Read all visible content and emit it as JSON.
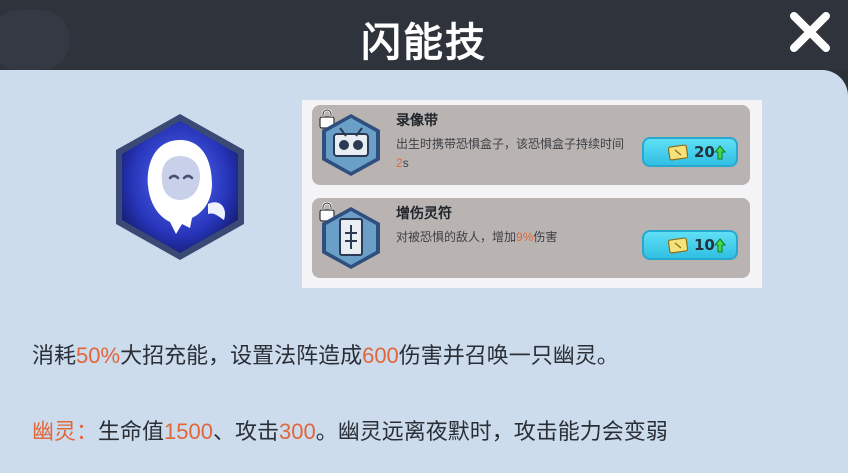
{
  "header": {
    "title": "闪能技"
  },
  "skill": {
    "icon": "hooded-ghost-icon"
  },
  "upgrades": [
    {
      "name": "录像带",
      "icon": "videotape-icon",
      "desc_pre": "出生时携带恐惧盒子，该恐惧盒子持续时间",
      "desc_value": "2",
      "desc_post": "s",
      "cost": "20",
      "locked": true
    },
    {
      "name": "增伤灵符",
      "icon": "talisman-icon",
      "desc_pre": "对被恐惧的敌人，增加",
      "desc_value": "9%",
      "desc_post": "伤害",
      "cost": "10",
      "locked": true
    }
  ],
  "description": {
    "line1": {
      "p1": "消耗",
      "v1": "50%",
      "p2": "大招充能，设置法阵造成",
      "v2": "600",
      "p3": "伤害并召唤一只幽灵。"
    },
    "line2": {
      "label": "幽灵：",
      "p1": "生命值",
      "v1": "1500",
      "p2": "、攻击",
      "v2": "300",
      "p3": "。幽灵远离夜默时，攻击能力会变弱"
    }
  },
  "colors": {
    "highlight": "#e2663a",
    "panel": "#ccdcec",
    "header": "#2f333b",
    "cost_button": "#31bfe3"
  }
}
